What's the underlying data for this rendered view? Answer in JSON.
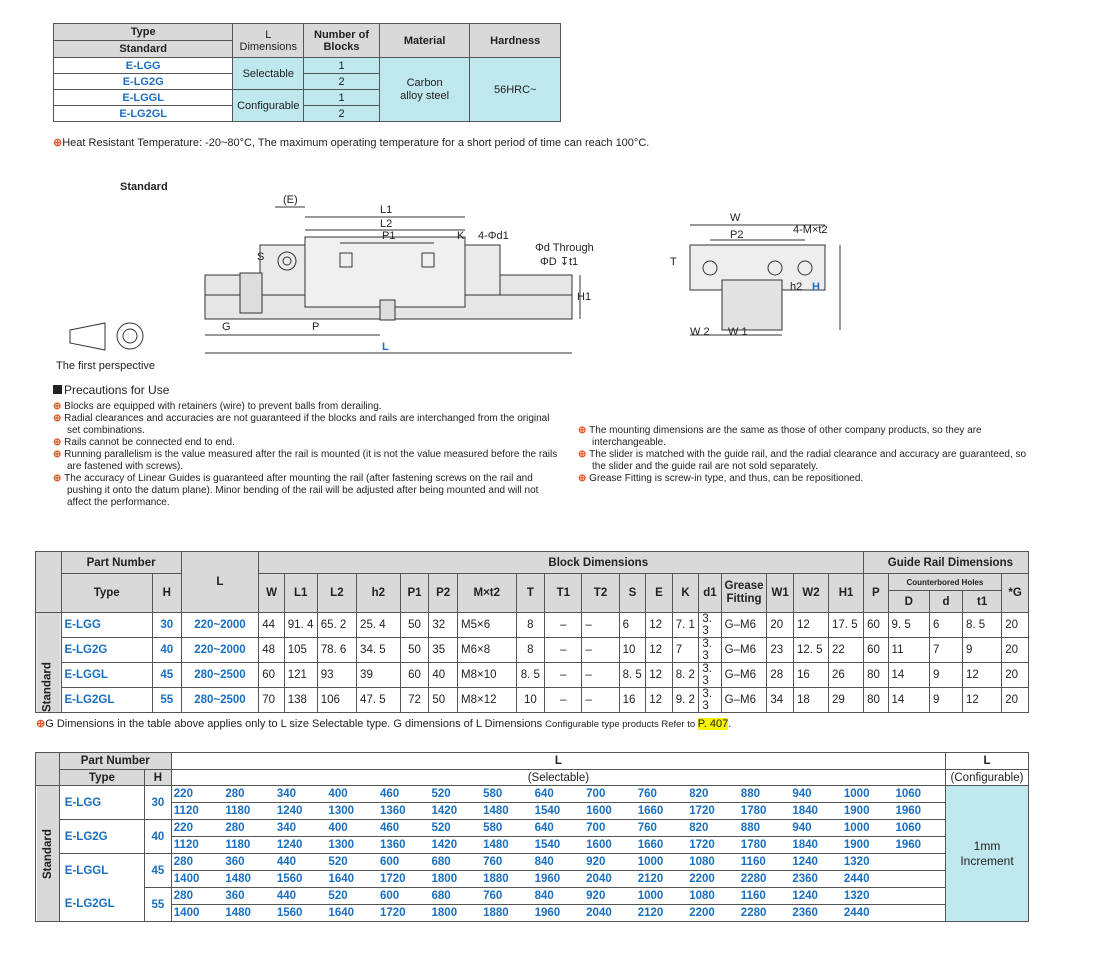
{
  "spec_table": {
    "headers": {
      "type": "Type",
      "standard": "Standard",
      "l_dimensions": "L\nDimensions",
      "num_blocks": "Number of\nBlocks",
      "material": "Material",
      "hardness": "Hardness"
    },
    "rows": [
      {
        "type": "E-LGG",
        "blocks": "1"
      },
      {
        "type": "E-LG2G",
        "blocks": "2"
      },
      {
        "type": "E-LGGL",
        "blocks": "1"
      },
      {
        "type": "E-LG2GL",
        "blocks": "2"
      }
    ],
    "selectable": "Selectable",
    "configurable": "Configurable",
    "material": "Carbon alloy steel",
    "hardness": "56HRC~"
  },
  "heat_note": "Heat Resistant Temperature: -20~80°C,  The maximum operating temperature for a short period of time can reach 100°C.",
  "drawing": {
    "standard": "Standard",
    "first_perspective": "The first perspective",
    "labels": {
      "E": "(E)",
      "L1": "L1",
      "L2": "L2",
      "P1": "P1",
      "K": "K",
      "hole": "4-Φd1",
      "through": "Φd Through",
      "counterbore": "ΦD ↧t1",
      "S": "S",
      "H1": "H1",
      "G": "G",
      "P": "P",
      "L": "L",
      "W": "W",
      "P2": "P2",
      "mxt2": "4-M×t2",
      "T": "T",
      "h2": "h2",
      "H": "H",
      "W2": "W 2",
      "W1": "W 1"
    }
  },
  "precautions": {
    "title": "Precautions for Use",
    "left": [
      "Blocks are equipped with retainers (wire) to prevent balls from derailing.",
      "Radial clearances and accuracies are not guaranteed if the blocks and rails are interchanged from the original set combinations.",
      "Rails cannot be connected end to end.",
      "Running parallelism is the value measured after the rail is mounted (it is not the value measured before the rails are fastened with screws).",
      "The accuracy of Linear Guides is guaranteed after mounting the rail (after fastening screws on the rail and pushing it onto the datum plane). Minor bending of the rail will be adjusted after being mounted and will not affect the performance."
    ],
    "right": [
      "The mounting dimensions are the same as those of other company products, so they are interchangeable.",
      "The slider is matched with the guide rail, and the radial clearance and accuracy are guaranteed, so the slider and the guide rail are not sold separately.",
      "Grease Fitting is screw-in type, and thus, can be repositioned."
    ]
  },
  "dims_table": {
    "part_number": "Part Number",
    "type": "Type",
    "H": "H",
    "L": "L",
    "block_dims": "Block Dimensions",
    "rail_dims": "Guide Rail Dimensions",
    "cols": [
      "W",
      "L1",
      "L2",
      "h2",
      "P1",
      "P2",
      "M×t2",
      "T",
      "T1",
      "T2",
      "S",
      "E",
      "K",
      "d1",
      "Grease Fitting",
      "W1",
      "W2",
      "H1",
      "P"
    ],
    "counterbored": "Counterbored Holes",
    "D": "D",
    "d": "d",
    "t1": "t1",
    "G": "*G",
    "side": "Standard",
    "rows": [
      [
        "E-LGG",
        "30",
        "220~2000",
        "44",
        "91. 4",
        "65. 2",
        "25. 4",
        "50",
        "32",
        "M5×6",
        "8",
        "–",
        "–",
        "6",
        "12",
        "7. 1",
        "3. 3",
        "G–M6",
        "20",
        "12",
        "17. 5",
        "60",
        "9. 5",
        "6",
        "8. 5",
        "20"
      ],
      [
        "E-LG2G",
        "40",
        "220~2000",
        "48",
        "105",
        "78. 6",
        "34. 5",
        "50",
        "35",
        "M6×8",
        "8",
        "–",
        "–",
        "10",
        "12",
        "7",
        "3. 3",
        "G–M6",
        "23",
        "12. 5",
        "22",
        "60",
        "11",
        "7",
        "9",
        "20"
      ],
      [
        "E-LGGL",
        "45",
        "280~2500",
        "60",
        "121",
        "93",
        "39",
        "60",
        "40",
        "M8×10",
        "8. 5",
        "–",
        "–",
        "8. 5",
        "12",
        "8. 2",
        "3. 3",
        "G–M6",
        "28",
        "16",
        "26",
        "80",
        "14",
        "9",
        "12",
        "20"
      ],
      [
        "E-LG2GL",
        "55",
        "280~2500",
        "70",
        "138",
        "106",
        "47. 5",
        "72",
        "50",
        "M8×12",
        "10",
        "–",
        "–",
        "16",
        "12",
        "9. 2",
        "3. 3",
        "G–M6",
        "34",
        "18",
        "29",
        "80",
        "14",
        "9",
        "12",
        "20"
      ]
    ]
  },
  "g_note": {
    "pre": "G Dimensions in the table above applies only to L size Selectable type.  G dimensions of L Dimensions ",
    "small": "Configurable type products Refer to ",
    "page": "P. 407",
    "post": "."
  },
  "length_table": {
    "part_number": "Part Number",
    "type": "Type",
    "H": "H",
    "L": "L",
    "selectable": "(Selectable)",
    "configurable": "(Configurable)",
    "side": "Standard",
    "increment": "1mm\nIncrement",
    "groups": [
      {
        "types": [
          "E-LGG"
        ],
        "H": "30",
        "rows": [
          [
            "220",
            "280",
            "340",
            "400",
            "460",
            "520",
            "580",
            "640",
            "700",
            "760",
            "820",
            "880",
            "940",
            "1000",
            "1060"
          ],
          [
            "1120",
            "1180",
            "1240",
            "1300",
            "1360",
            "1420",
            "1480",
            "1540",
            "1600",
            "1660",
            "1720",
            "1780",
            "1840",
            "1900",
            "1960"
          ]
        ]
      },
      {
        "types": [
          "E-LG2G"
        ],
        "H": "40",
        "rows": [
          [
            "220",
            "280",
            "340",
            "400",
            "460",
            "520",
            "580",
            "640",
            "700",
            "760",
            "820",
            "880",
            "940",
            "1000",
            "1060"
          ],
          [
            "1120",
            "1180",
            "1240",
            "1300",
            "1360",
            "1420",
            "1480",
            "1540",
            "1600",
            "1660",
            "1720",
            "1780",
            "1840",
            "1900",
            "1960"
          ]
        ]
      },
      {
        "types": [
          "E-LGGL"
        ],
        "H": "45",
        "rows": [
          [
            "280",
            "360",
            "440",
            "520",
            "600",
            "680",
            "760",
            "840",
            "920",
            "1000",
            "1080",
            "1160",
            "1240",
            "1320",
            ""
          ],
          [
            "1400",
            "1480",
            "1560",
            "1640",
            "1720",
            "1800",
            "1880",
            "1960",
            "2040",
            "2120",
            "2200",
            "2280",
            "2360",
            "2440",
            ""
          ]
        ]
      },
      {
        "types": [
          "E-LG2GL"
        ],
        "H": "55",
        "rows": [
          [
            "280",
            "360",
            "440",
            "520",
            "600",
            "680",
            "760",
            "840",
            "920",
            "1000",
            "1080",
            "1160",
            "1240",
            "1320",
            ""
          ],
          [
            "1400",
            "1480",
            "1560",
            "1640",
            "1720",
            "1800",
            "1880",
            "1960",
            "2040",
            "2120",
            "2200",
            "2280",
            "2360",
            "2440",
            ""
          ]
        ]
      }
    ]
  }
}
